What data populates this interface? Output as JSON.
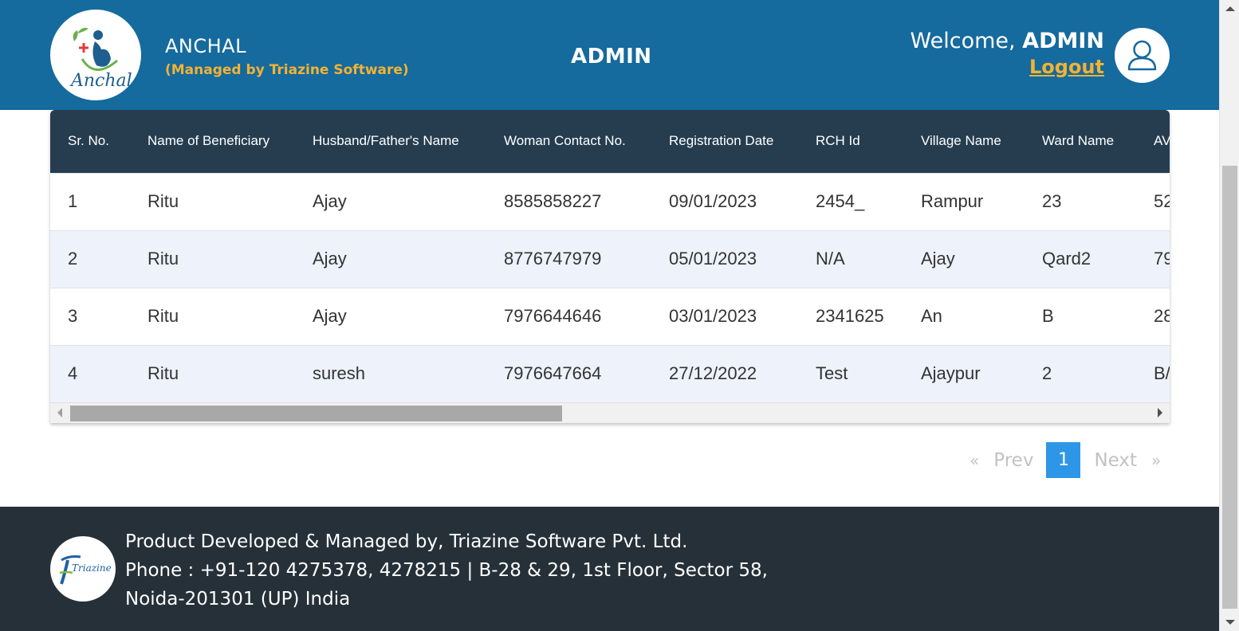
{
  "header": {
    "logo_text": "Anchal",
    "brand_name": "ANCHAL",
    "brand_sub": "(Managed by Triazine Software)",
    "center_title": "ADMIN",
    "welcome_prefix": "Welcome, ",
    "welcome_user": "ADMIN",
    "logout_label": "Logout",
    "avatar_icon": "user-icon"
  },
  "table": {
    "columns": [
      "Sr. No.",
      "Name of Beneficiary",
      "Husband/Father's Name",
      "Woman Contact No.",
      "Registration Date",
      "RCH Id",
      "Village Name",
      "Ward Name",
      "AV"
    ],
    "rows": [
      [
        "1",
        "Ritu",
        "Ajay",
        "8585858227",
        "09/01/2023",
        "2454_",
        "Rampur",
        "23",
        "52"
      ],
      [
        "2",
        "Ritu",
        "Ajay",
        "8776747979",
        "05/01/2023",
        "N/A",
        "Ajay",
        "Qard2",
        "79"
      ],
      [
        "3",
        "Ritu",
        "Ajay",
        "7976644646",
        "03/01/2023",
        "2341625",
        "An",
        "B",
        "28"
      ],
      [
        "4",
        "Ritu",
        "suresh",
        "7976647664",
        "27/12/2022",
        "Test",
        "Ajaypur",
        "2",
        "B/"
      ]
    ]
  },
  "pagination": {
    "first": "«",
    "prev": "Prev",
    "current": "1",
    "next": "Next",
    "last": "»"
  },
  "footer": {
    "logo_text": "Triazine",
    "line1": "Product Developed & Managed by, Triazine Software Pvt. Ltd.",
    "line2": "Phone : +91-120 4275378, 4278215 | B-28 & 29, 1st Floor, Sector 58, Noida-201301 (UP) India"
  },
  "colors": {
    "header_bg": "#156a9e",
    "accent_gold": "#f3b233",
    "table_header_bg": "#263d4f",
    "row_alt_bg": "#edf2fb",
    "page_active": "#2e96e6",
    "footer_bg": "#263038"
  }
}
